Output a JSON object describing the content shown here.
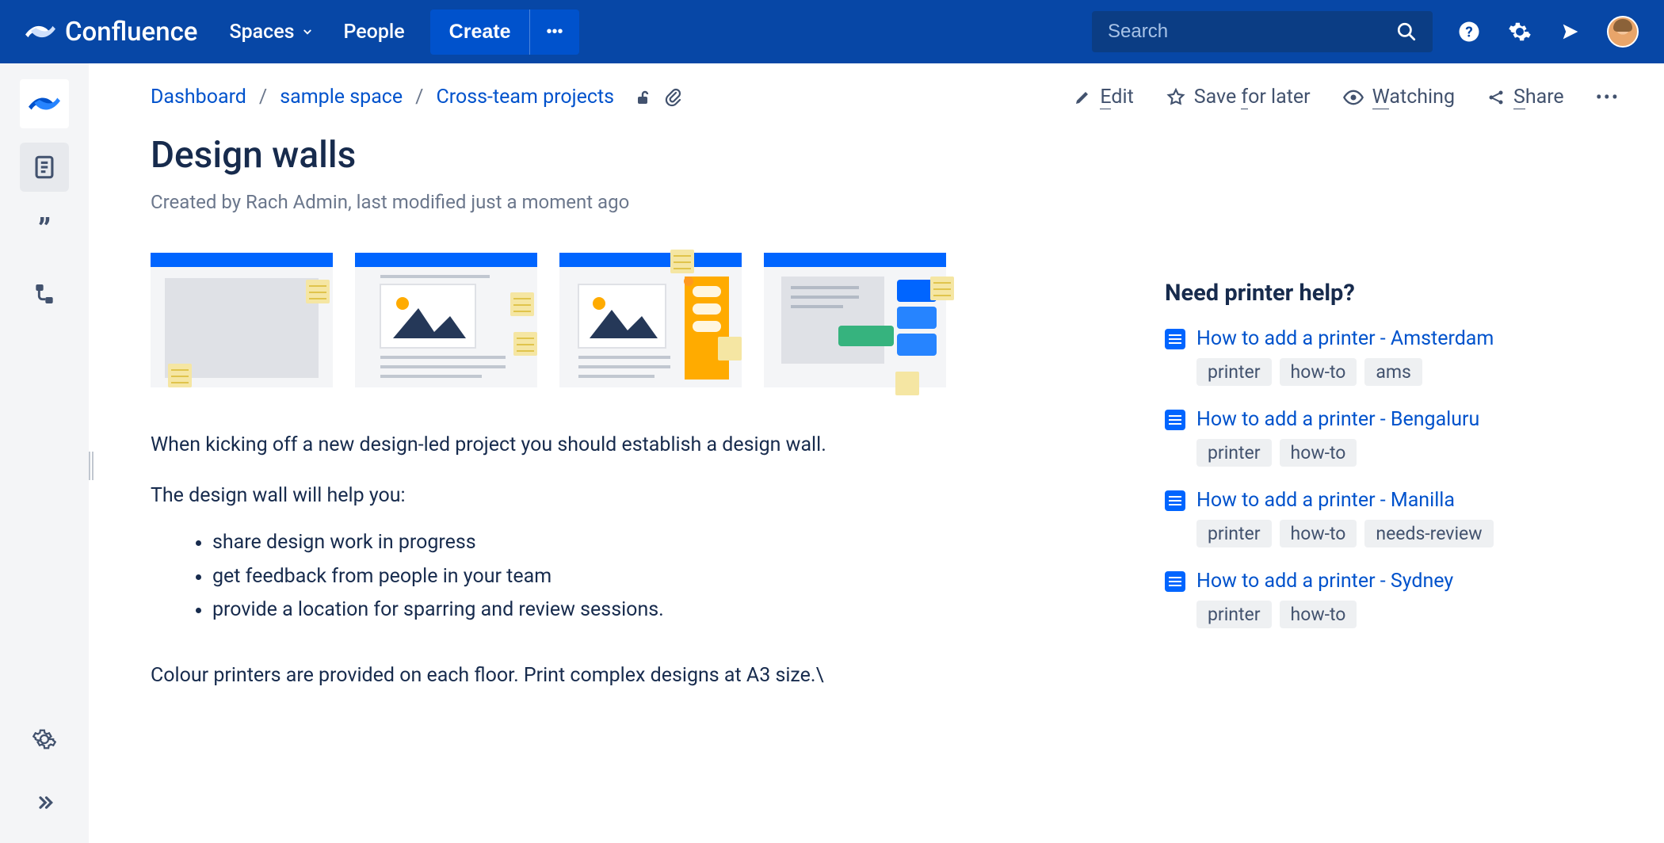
{
  "brand": "Confluence",
  "nav": {
    "spaces": "Spaces",
    "people": "People",
    "create": "Create"
  },
  "search": {
    "placeholder": "Search"
  },
  "breadcrumbs": {
    "dashboard": "Dashboard",
    "space": "sample space",
    "parent": "Cross-team projects"
  },
  "actions": {
    "edit": "Edit",
    "save": "Save for later",
    "watching": "Watching",
    "share": "Share"
  },
  "page": {
    "title": "Design walls",
    "byline": "Created by Rach Admin, last modified just a moment ago",
    "p1": "When kicking off a new design-led project you should establish a design wall.",
    "p2": "The design wall will help you:",
    "b1": "share design work in progress",
    "b2": "get feedback from people in your team",
    "b3": "provide a location for sparring and review sessions.",
    "p3": "Colour printers are provided on each floor. Print complex designs at A3 size.\\"
  },
  "sidebar": {
    "heading": "Need printer help?",
    "items": [
      {
        "title": "How to add a printer - Amsterdam",
        "tags": [
          "printer",
          "how-to",
          "ams"
        ]
      },
      {
        "title": "How to add a printer - Bengaluru",
        "tags": [
          "printer",
          "how-to"
        ]
      },
      {
        "title": "How to add a printer - Manilla",
        "tags": [
          "printer",
          "how-to",
          "needs-review"
        ]
      },
      {
        "title": "How to add a printer - Sydney",
        "tags": [
          "printer",
          "how-to"
        ]
      }
    ]
  }
}
